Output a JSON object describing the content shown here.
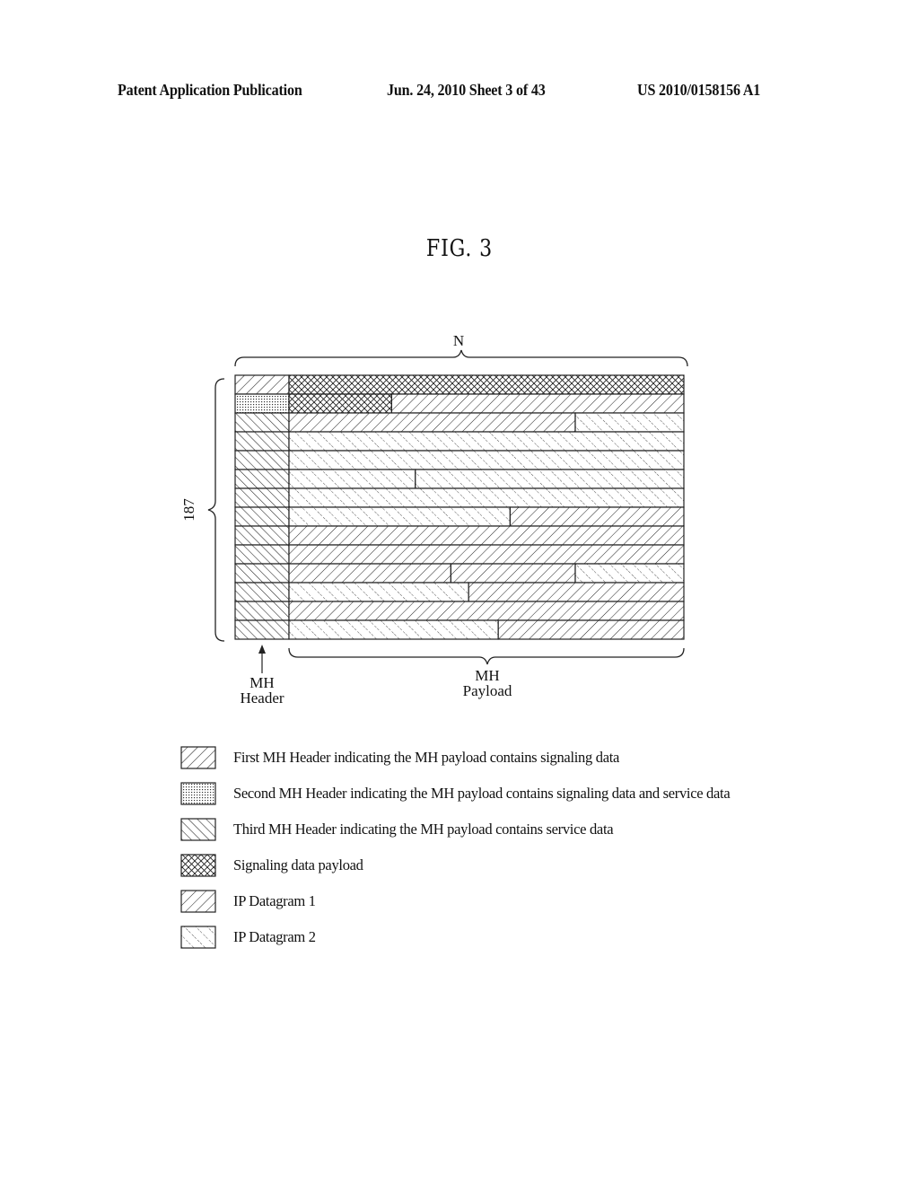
{
  "header": {
    "left": "Patent Application Publication",
    "middle": "Jun. 24, 2010  Sheet 3 of 43",
    "right": "US 2010/0158156 A1"
  },
  "figure": {
    "title": "FIG. 3",
    "width_label": "N",
    "height_label": "187",
    "header_label_line1": "MH",
    "header_label_line2": "Header",
    "payload_label_line1": "MH",
    "payload_label_line2": "Payload",
    "rows": [
      {
        "header": "first",
        "segments": [
          {
            "type": "signaling",
            "fraction": 1.0
          }
        ]
      },
      {
        "header": "second",
        "segments": [
          {
            "type": "signaling",
            "fraction": 0.26
          },
          {
            "type": "ip1",
            "fraction": 0.74
          }
        ]
      },
      {
        "header": "third",
        "segments": [
          {
            "type": "ip1",
            "fraction": 0.725
          },
          {
            "type": "ip2",
            "fraction": 0.275
          }
        ]
      },
      {
        "header": "third",
        "segments": [
          {
            "type": "ip2",
            "fraction": 1.0
          }
        ]
      },
      {
        "header": "third",
        "segments": [
          {
            "type": "ip2",
            "fraction": 1.0
          }
        ]
      },
      {
        "header": "third",
        "segments": [
          {
            "type": "ip2",
            "fraction": 0.32
          },
          {
            "type": "ip2",
            "fraction": 0.68
          }
        ]
      },
      {
        "header": "third",
        "segments": [
          {
            "type": "ip2",
            "fraction": 1.0
          }
        ]
      },
      {
        "header": "third",
        "segments": [
          {
            "type": "ip2",
            "fraction": 0.56
          },
          {
            "type": "ip1",
            "fraction": 0.44
          }
        ]
      },
      {
        "header": "third",
        "segments": [
          {
            "type": "ip1",
            "fraction": 1.0
          }
        ]
      },
      {
        "header": "third",
        "segments": [
          {
            "type": "ip1",
            "fraction": 1.0
          }
        ]
      },
      {
        "header": "third",
        "segments": [
          {
            "type": "ip1",
            "fraction": 0.41
          },
          {
            "type": "ip1",
            "fraction": 0.315
          },
          {
            "type": "ip2",
            "fraction": 0.275
          }
        ]
      },
      {
        "header": "third",
        "segments": [
          {
            "type": "ip2",
            "fraction": 0.455
          },
          {
            "type": "ip1",
            "fraction": 0.545
          }
        ]
      },
      {
        "header": "third",
        "segments": [
          {
            "type": "ip1",
            "fraction": 1.0
          }
        ]
      },
      {
        "header": "third",
        "segments": [
          {
            "type": "ip2",
            "fraction": 0.53
          },
          {
            "type": "ip1",
            "fraction": 0.47
          }
        ]
      }
    ]
  },
  "legend": [
    {
      "pattern": "first",
      "label": "First MH Header indicating the MH payload contains signaling data"
    },
    {
      "pattern": "second",
      "label": "Second MH Header indicating the MH payload contains signaling data and service data"
    },
    {
      "pattern": "third",
      "label": "Third MH Header indicating the MH payload contains service data"
    },
    {
      "pattern": "signaling",
      "label": "Signaling data payload"
    },
    {
      "pattern": "ip1",
      "label": "IP Datagram 1"
    },
    {
      "pattern": "ip2",
      "label": "IP Datagram 2"
    }
  ]
}
